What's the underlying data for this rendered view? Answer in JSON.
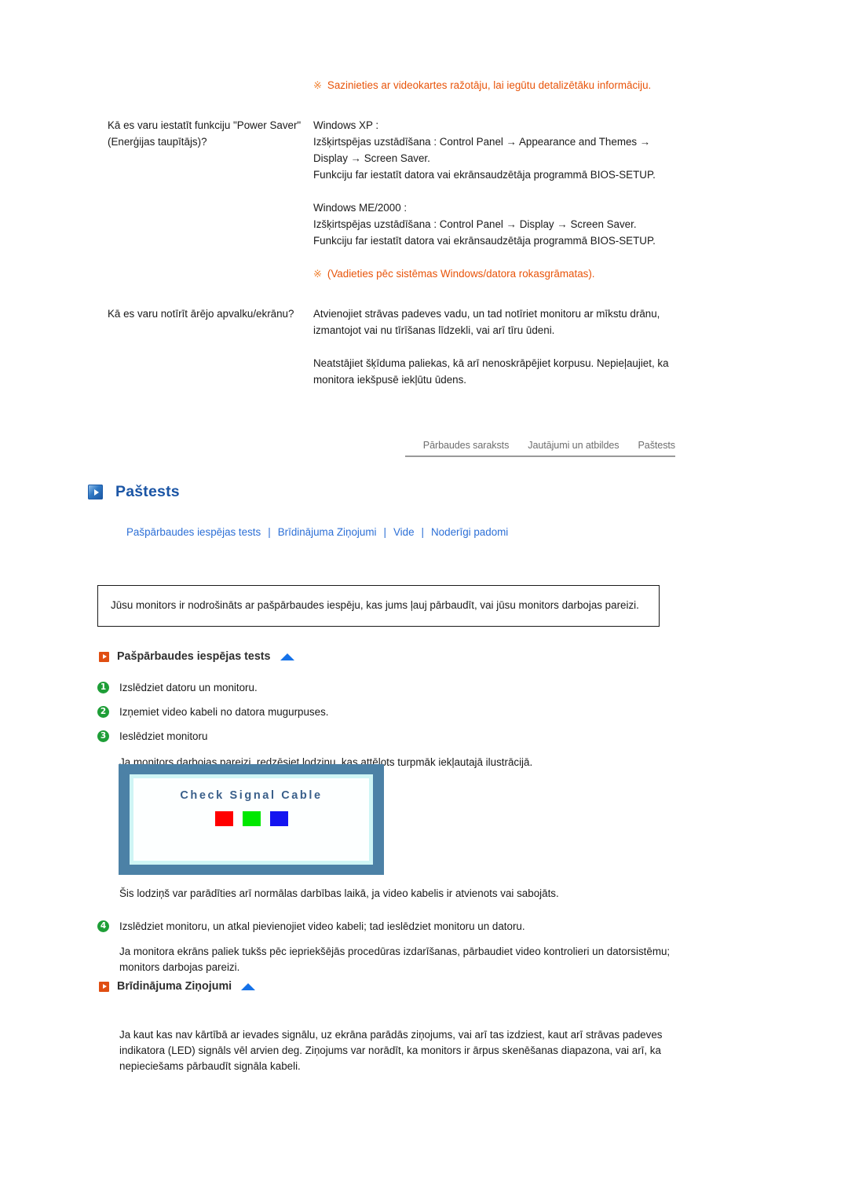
{
  "faq": {
    "top_note": {
      "mark": "※",
      "text": "Sazinieties ar videokartes ražotāju, lai iegūtu detalizētāku informāciju."
    },
    "rows": [
      {
        "question": "Kā es varu iestatīt funkciju \"Power Saver\" (Enerģijas taupītājs)?",
        "answer_blocks": [
          "Windows XP :",
          "Izšķirtspējas uzstādīšana : Control Panel → Appearance and Themes → Display → Screen Saver.",
          "Funkciju far iestatīt datora vai ekrānsaudzētāja programmā BIOS-SETUP.",
          "Windows ME/2000 :",
          "Izšķirtspējas uzstādīšana : Control Panel → Display → Screen Saver.",
          "Funkciju far iestatīt datora vai ekrānsaudzētāja programmā BIOS-SETUP."
        ],
        "note": {
          "mark": "※",
          "text": "(Vadieties pēc sistēmas Windows/datora rokasgrāmatas)."
        }
      },
      {
        "question": "Kā es varu notīrīt ārējo apvalku/ekrānu?",
        "answer_blocks": [
          "Atvienojiet strāvas padeves vadu, un tad notīriet monitoru ar mīkstu drānu, izmantojot vai nu tīrīšanas līdzekli, vai arī tīru ūdeni.",
          "Neatstājiet šķīduma paliekas, kā arī nenoskrāpējiet korpusu. Nepieļaujiet, ka monitora iekšpusē iekļūtu ūdens."
        ]
      }
    ]
  },
  "tabs": [
    {
      "label": "Pārbaudes saraksts"
    },
    {
      "label": "Jautājumi un atbildes"
    },
    {
      "label": "Paštests"
    }
  ],
  "page_title": {
    "text": "Paštests",
    "icon": "blue-play-square-icon",
    "color": "#1B55A5"
  },
  "subnav": {
    "separator": "|",
    "items": [
      {
        "label": "Pašpārbaudes iespējas tests"
      },
      {
        "label": "Brīdinājuma Ziņojumi"
      },
      {
        "label": "Vide"
      },
      {
        "label": "Noderīgi padomi"
      }
    ]
  },
  "intro_box": {
    "text": "Jūsu monitors ir nodrošināts ar pašpārbaudes iespēju, kas jums ļauj pārbaudīt, vai jūsu monitors darbojas pareizi."
  },
  "sections": [
    {
      "title": "Pašpārbaudes iespējas tests",
      "icon": "orange-play-square-icon",
      "top_arrow": "up-triangle-icon"
    },
    {
      "title": "Brīdinājuma Ziņojumi",
      "icon": "orange-play-square-icon",
      "top_arrow": "up-triangle-icon"
    }
  ],
  "steps": [
    {
      "num": "1",
      "text": "Izslēdziet datoru un monitoru."
    },
    {
      "num": "2",
      "text": "Izņemiet video kabeli no datora mugurpuses."
    },
    {
      "num": "3",
      "text": "Ieslēdziet monitoru"
    }
  ],
  "after_steps_note": "Ja monitors darbojas pareizi, redzēsiet lodziņu, kas attēlots turpmāk iekļautajā ilustrācijā.",
  "monitor_image": {
    "message": "Check Signal Cable",
    "bezel_color": "#4C81A6",
    "inner_color": "#CFF5F5",
    "screen_color": "#FDFFFF",
    "text_color": "#3A5F8A",
    "swatches": [
      {
        "name": "red-swatch",
        "color": "#FF0000"
      },
      {
        "name": "green-swatch",
        "color": "#00E800"
      },
      {
        "name": "blue-swatch",
        "color": "#1414F0"
      }
    ]
  },
  "after_image_note": "Šis lodziņš var parādīties arī normālas darbības laikā, ja video kabelis ir atvienots vai sabojāts.",
  "step4": {
    "num": "4",
    "text": "Izslēdziet monitoru, un atkal pievienojiet video kabeli; tad ieslēdziet monitoru un datoru."
  },
  "step4_note": "Ja monitora ekrāns paliek tukšs pēc iepriekšējās procedūras izdarīšanas, pārbaudiet video kontrolieri un datorsistēmu; monitors darbojas pareizi.",
  "warning_body": "Ja kaut kas nav kārtībā ar ievades signālu, uz ekrāna parādās ziņojums, vai arī tas izdziest, kaut arī strāvas padeves indikatora (LED) signāls vēl arvien deg. Ziņojums var norādīt, ka monitors ir ārpus skenēšanas diapazona, vai arī, ka nepieciešams pārbaudīt signāla kabeli."
}
